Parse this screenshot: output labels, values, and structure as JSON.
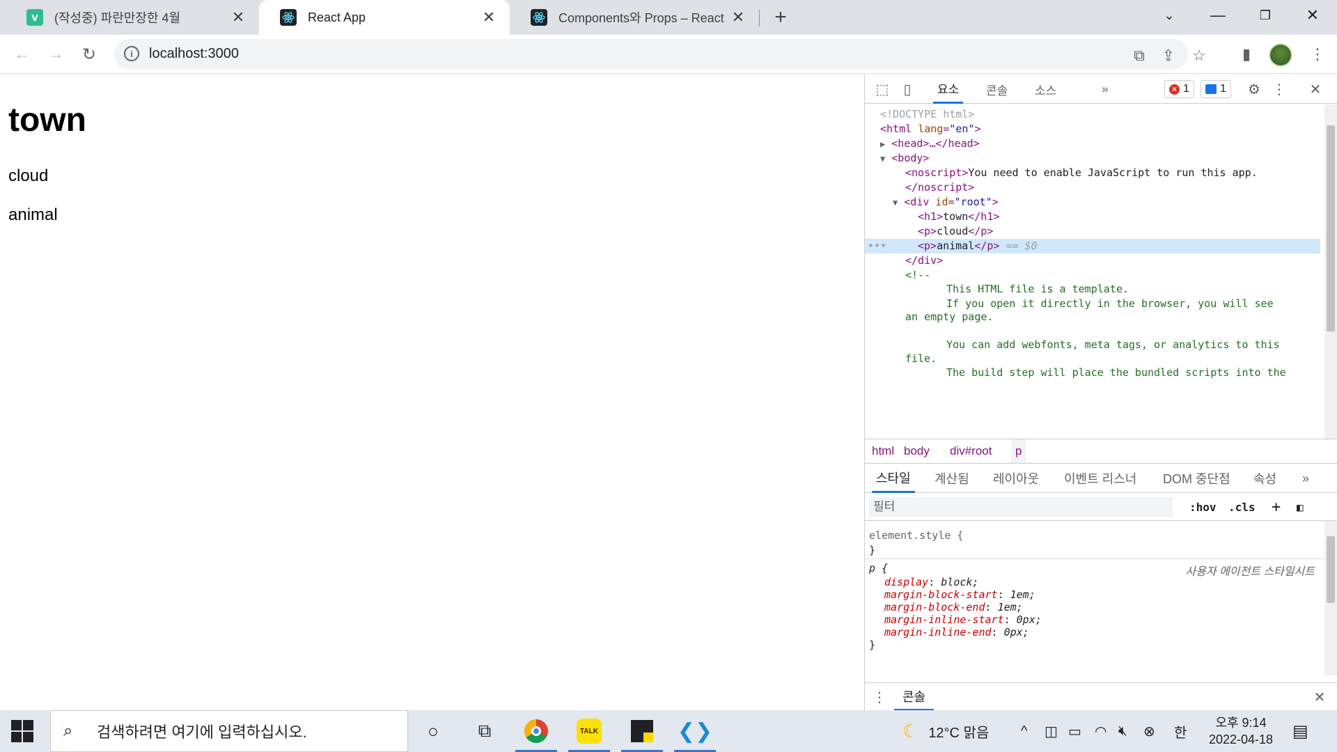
{
  "browser": {
    "tabs": [
      {
        "title": "(작성중) 파란만장한 4월",
        "favicon": "v-icon"
      },
      {
        "title": "React App",
        "favicon": "react-icon",
        "active": true
      },
      {
        "title": "Components와 Props – React",
        "favicon": "react-icon"
      }
    ],
    "close_glyph": "✕",
    "new_tab_glyph": "+",
    "address": "localhost:3000"
  },
  "page": {
    "heading": "town",
    "paragraphs": [
      "cloud",
      "animal"
    ]
  },
  "devtools": {
    "tabs": [
      "요소",
      "콘솔",
      "소스"
    ],
    "more": "»",
    "error_count": "1",
    "message_count": "1",
    "dom_lines": {
      "doctype": "<!DOCTYPE html>",
      "html_open_tag": "<html",
      "html_attr": "lang",
      "html_attr_val": "\"en\"",
      "head": "<head>…</head>",
      "body_open": "<body>",
      "noscript_open": "<noscript>",
      "noscript_text": "You need to enable JavaScript to run this app.",
      "noscript_close": "</noscript>",
      "div_open_tag": "<div",
      "div_attr": "id",
      "div_attr_val": "\"root\"",
      "h1_open": "<h1>",
      "h1_text": "town",
      "h1_close": "</h1>",
      "p_open": "<p>",
      "p1_text": "cloud",
      "p_close": "</p>",
      "p2_text": "animal",
      "selected_marker": "== $0",
      "div_close": "</div>",
      "comment_open": "<!--",
      "comment_1": "This HTML file is a template.",
      "comment_2": "If you open it directly in the browser, you will see",
      "comment_3": "an empty page.",
      "comment_4": "You can add webfonts, meta tags, or analytics to this",
      "comment_5": "file.",
      "comment_6": "The build step will place the bundled scripts into the"
    },
    "breadcrumbs": [
      "html",
      "body",
      "div#root",
      "p"
    ],
    "sub_tabs": [
      "스타일",
      "계산됨",
      "레이아웃",
      "이벤트 리스너",
      "DOM 중단점",
      "속성"
    ],
    "filter_placeholder": "필터",
    "hov": ":hov",
    "cls": ".cls",
    "styles": {
      "element_style": "element.style {",
      "close_brace": "}",
      "p_selector": "p {",
      "ua_label": "사용자 에이전트 스타일시트",
      "props": [
        {
          "name": "display",
          "value": "block;"
        },
        {
          "name": "margin-block-start",
          "value": "1em;"
        },
        {
          "name": "margin-block-end",
          "value": "1em;"
        },
        {
          "name": "margin-inline-start",
          "value": "0px;"
        },
        {
          "name": "margin-inline-end",
          "value": "0px;"
        }
      ]
    },
    "drawer_tab": "콘솔"
  },
  "taskbar": {
    "search_placeholder": "검색하려면 여기에 입력하십시오.",
    "weather": "12°C 맑음",
    "ime": "한",
    "time": "오후 9:14",
    "date": "2022-04-18"
  },
  "colors": {
    "accent": "#1a73e8",
    "tag": "#881280",
    "attr": "#994500",
    "attr_value": "#1a1aa6",
    "comment": "#236e25",
    "selected_row": "#cfe8fc"
  }
}
